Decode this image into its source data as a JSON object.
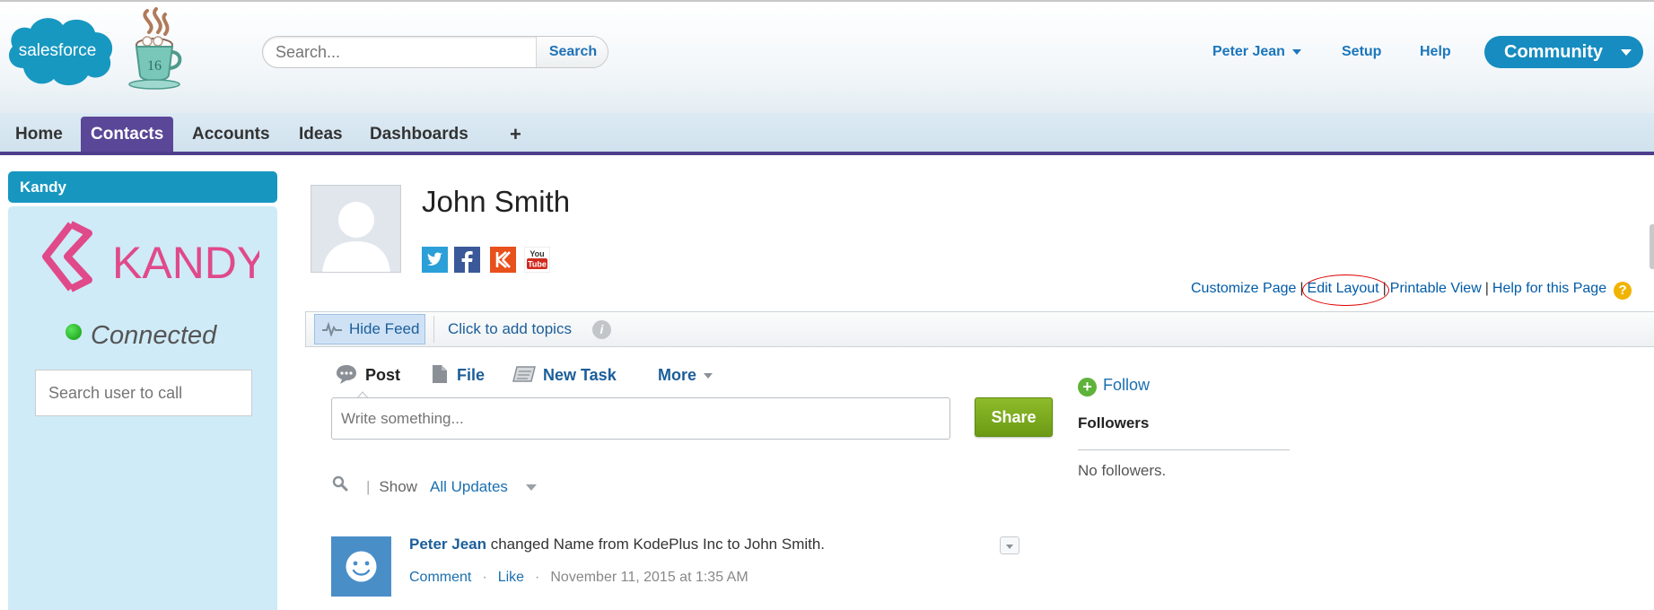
{
  "header": {
    "search_placeholder": "Search...",
    "search_button": "Search",
    "cup_badge": "16",
    "user_menu": "Peter Jean",
    "setup": "Setup",
    "help": "Help",
    "community": "Community",
    "logo_text": "salesforce"
  },
  "tabs": [
    {
      "label": "Home"
    },
    {
      "label": "Contacts",
      "active": true
    },
    {
      "label": "Accounts"
    },
    {
      "label": "Ideas"
    },
    {
      "label": "Dashboards"
    },
    {
      "label": "+"
    }
  ],
  "sidebar": {
    "title": "Kandy",
    "logo_text": "KANDY.",
    "status": "Connected",
    "call_placeholder": "Search user to call"
  },
  "contact": {
    "name": "John Smith",
    "social": [
      "twitter-icon",
      "facebook-icon",
      "klout-icon",
      "youtube-icon"
    ]
  },
  "page_links": {
    "customize": "Customize Page",
    "edit_layout": "Edit Layout",
    "printable": "Printable View",
    "help_page": "Help for this Page"
  },
  "feed": {
    "hide_feed": "Hide Feed",
    "add_topics": "Click to add topics",
    "publisher": {
      "post": "Post",
      "file": "File",
      "new_task": "New Task",
      "more": "More",
      "placeholder": "Write something...",
      "share": "Share"
    },
    "filter": {
      "show": "Show",
      "value": "All Updates"
    },
    "item": {
      "author": "Peter Jean",
      "text": " changed Name from KodePlus Inc to John Smith.",
      "comment": "Comment",
      "like": "Like",
      "timestamp": "November 11, 2015 at 1:35 AM"
    }
  },
  "followers": {
    "follow": "Follow",
    "title": "Followers",
    "empty": "No followers."
  },
  "colors": {
    "brand_blue": "#168cc0",
    "active_tab": "#5a4797",
    "share_green": "#7aa81f"
  }
}
